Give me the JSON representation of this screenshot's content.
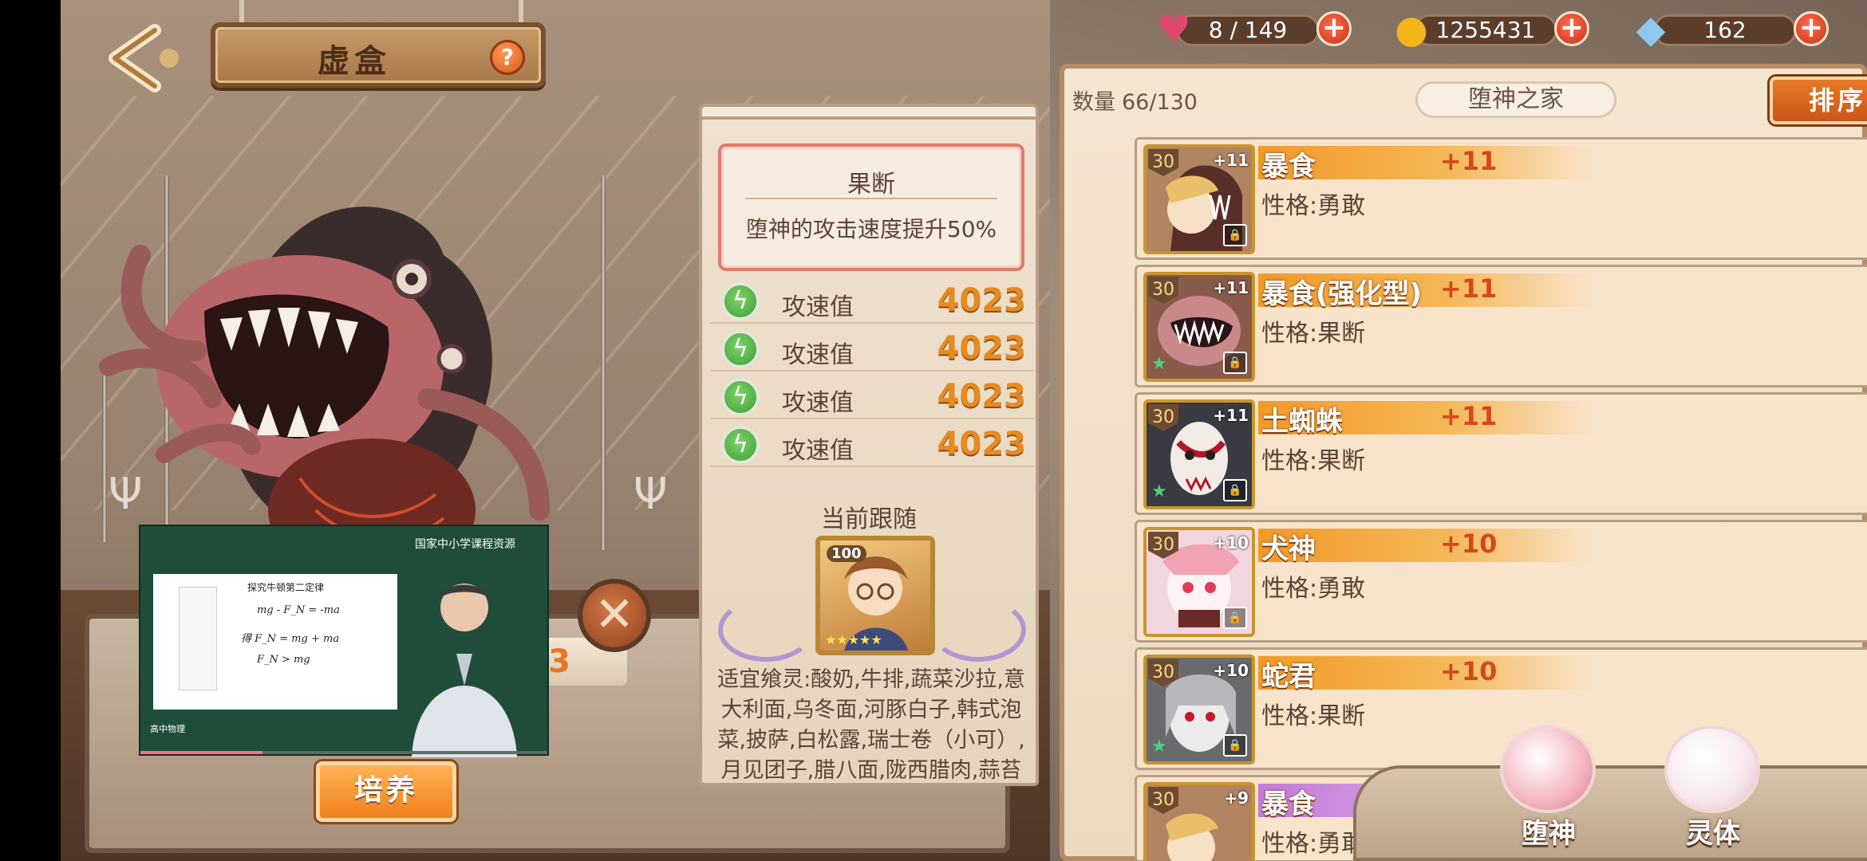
{
  "header": {
    "title": "虚盒",
    "help_label": "?"
  },
  "resources": {
    "stamina": "8 / 149",
    "gold": "1255431",
    "crystal": "162"
  },
  "video_overlay": {
    "channel_title": "国家中小学课程资源",
    "board_title": "探究牛顿第二定律",
    "line1": "mg - F_N = -ma",
    "line2": "得   F_N = mg + ma",
    "line3": "F_N > mg",
    "tag": "高中物理",
    "progress": 0.3
  },
  "scene": {
    "cultivate_label": "培养",
    "orange_value": "3"
  },
  "detail": {
    "trait_name": "果断",
    "trait_desc": "堕神的攻击速度提升50%",
    "stats": [
      {
        "label": "攻速值",
        "value": "4023"
      },
      {
        "label": "攻速值",
        "value": "4023"
      },
      {
        "label": "攻速值",
        "value": "4023"
      },
      {
        "label": "攻速值",
        "value": "4023"
      }
    ],
    "follow_title": "当前跟随",
    "follow_level": "100",
    "food_text": "适宜飨灵:酸奶,牛排,蔬菜沙拉,意大利面,乌冬面,河豚白子,韩式泡菜,披萨,白松露,瑞士卷（小可）,月见团子,腊八面,陇西腊肉,蒜苔虾糕,泡盛,啤酒,三"
  },
  "list": {
    "count_label": "数量",
    "count_value": "66/130",
    "home_label": "堕神之家",
    "sort_label": "排序",
    "cards": [
      {
        "level": "30",
        "plus": "+11",
        "name": "暴食",
        "bonus": "+11",
        "trait": "性格:勇敢",
        "color": "orange"
      },
      {
        "level": "30",
        "plus": "+11",
        "name": "暴食(强化型)",
        "bonus": "+11",
        "trait": "性格:果断",
        "color": "orange"
      },
      {
        "level": "30",
        "plus": "+11",
        "name": "土蜘蛛",
        "bonus": "+11",
        "trait": "性格:果断",
        "color": "orange"
      },
      {
        "level": "30",
        "plus": "+10",
        "name": "犬神",
        "bonus": "+10",
        "trait": "性格:勇敢",
        "color": "orange"
      },
      {
        "level": "30",
        "plus": "+10",
        "name": "蛇君",
        "bonus": "+10",
        "trait": "性格:果断",
        "color": "orange"
      },
      {
        "level": "30",
        "plus": "+9",
        "name": "暴食",
        "bonus": "",
        "trait": "性格:勇敢",
        "color": "purple"
      }
    ]
  },
  "tabs": {
    "fallen_god": "堕神",
    "spirit": "灵体"
  },
  "colors": {
    "accent_orange": "#e97a27",
    "stat_value": "#e58b22",
    "bonus_red": "#d24a1a",
    "panel_bg": "#f5e6d1"
  }
}
